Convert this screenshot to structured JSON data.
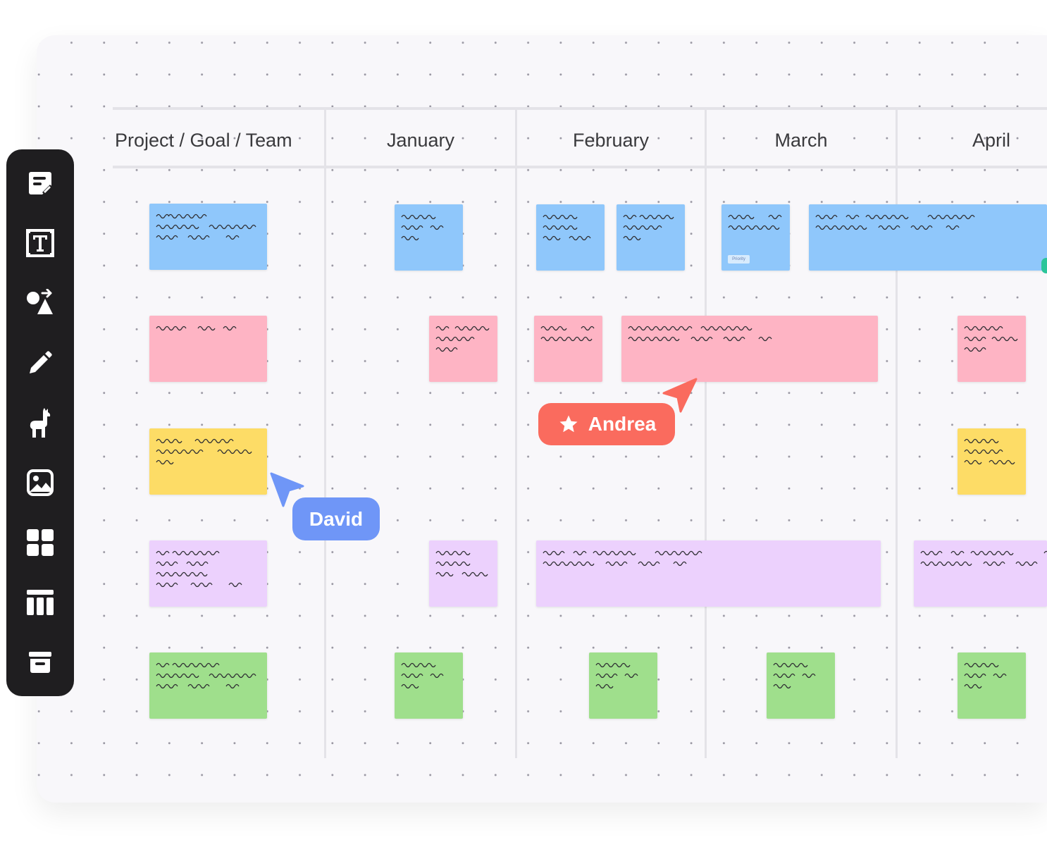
{
  "columns": {
    "project": "Project / Goal / Team",
    "jan": "January",
    "feb": "February",
    "mar": "March",
    "apr": "April"
  },
  "toolbar": [
    {
      "name": "sticky-note-icon"
    },
    {
      "name": "text-icon"
    },
    {
      "name": "shapes-icon"
    },
    {
      "name": "pencil-icon"
    },
    {
      "name": "llama-icon"
    },
    {
      "name": "image-icon"
    },
    {
      "name": "templates-icon"
    },
    {
      "name": "table-icon"
    },
    {
      "name": "archive-icon"
    }
  ],
  "tags": {
    "priority": "Priority"
  },
  "cursors": {
    "david": {
      "label": "David",
      "color": "#6f96f7"
    },
    "andrea": {
      "label": "Andrea",
      "color": "#fa6b5e"
    }
  },
  "note_colors": {
    "blue": "#8fc7fb",
    "pink": "#feb4c4",
    "yellow": "#fddc66",
    "purple": "#ecd1fd",
    "green": "#9fdf8c"
  }
}
